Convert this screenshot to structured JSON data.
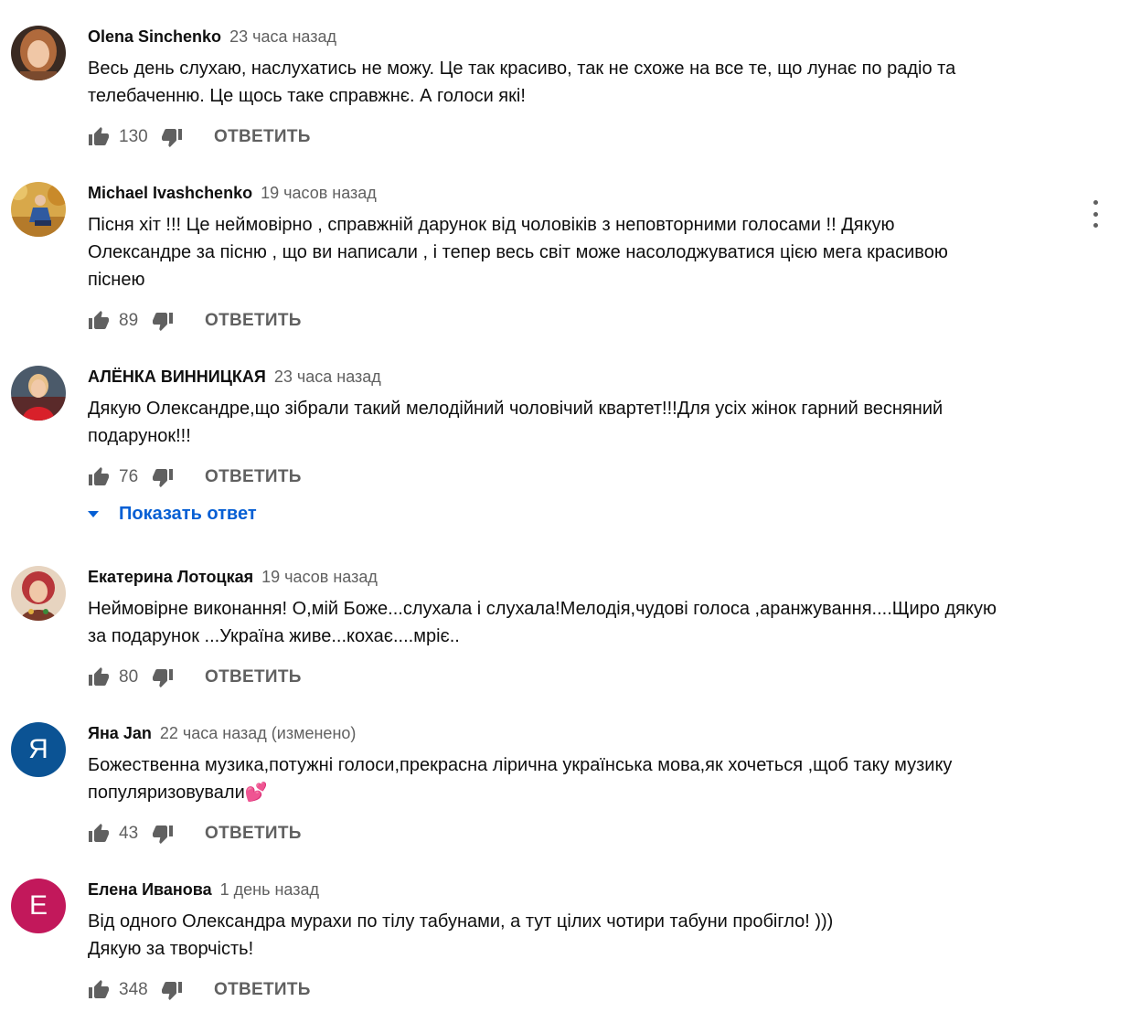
{
  "comments": [
    {
      "author": "Olena Sinchenko",
      "time": "23 часа назад",
      "text": "Весь день слухаю, наслухатись не можу. Це так красиво, так не схоже на все те, що лунає по радіо та\nтелебаченню. Це щось таке справжнє. А голоси які!",
      "likes": "130",
      "reply_label": "ОТВЕТИТЬ",
      "avatar": {
        "type": "photo",
        "color": "#b06a3c"
      }
    },
    {
      "author": "Michael Ivashchenko",
      "time": "19 часов назад",
      "text": "Пісня хіт !!! Це неймовірно , справжній дарунок від чоловіків з неповторними голосами !! Дякую\nОлександре за пісню , що ви написали , і тепер весь світ може насолоджуватися цією мега красивою\nпіснею",
      "likes": "89",
      "reply_label": "ОТВЕТИТЬ",
      "avatar": {
        "type": "photo",
        "color": "#c9963a"
      }
    },
    {
      "author": "АЛЁНКА ВИННИЦКАЯ",
      "time": "23 часа назад",
      "text": "Дякую Олександре,що зібрали такий мелодійний чоловічий квартет!!!Для усіх жінок гарний весняний\nподарунок!!!",
      "likes": "76",
      "reply_label": "ОТВЕТИТЬ",
      "show_replies": "Показать ответ",
      "avatar": {
        "type": "photo",
        "color": "#c0202a"
      }
    },
    {
      "author": "Екатерина Лотоцкая",
      "time": "19 часов назад",
      "text": "Неймовірне виконання! О,мій Боже...слухала і слухала!Мелодія,чудові голоса ,аранжування....Щиро дякую\nза подарунок ...Україна живе...кохає....мріє..",
      "likes": "80",
      "reply_label": "ОТВЕТИТЬ",
      "avatar": {
        "type": "photo",
        "color": "#d24f4f"
      }
    },
    {
      "author": "Яна Jan",
      "time": "22 часа назад (изменено)",
      "text": "Божественна музика,потужні голоси,прекрасна лірична українська мова,як хочеться ,щоб таку музику\nпопуляризовували💕",
      "likes": "43",
      "reply_label": "ОТВЕТИТЬ",
      "avatar": {
        "type": "letter",
        "letter": "Я",
        "color": "#0b5394"
      }
    },
    {
      "author": "Елена Иванова",
      "time": "1 день назад",
      "text": "Від одного Олександра мурахи по тілу табунами, а тут цілих чотири табуни пробігло! )))\nДякую за творчість!",
      "likes": "348",
      "reply_label": "ОТВЕТИТЬ",
      "avatar": {
        "type": "letter",
        "letter": "Е",
        "color": "#c2185b"
      }
    }
  ]
}
